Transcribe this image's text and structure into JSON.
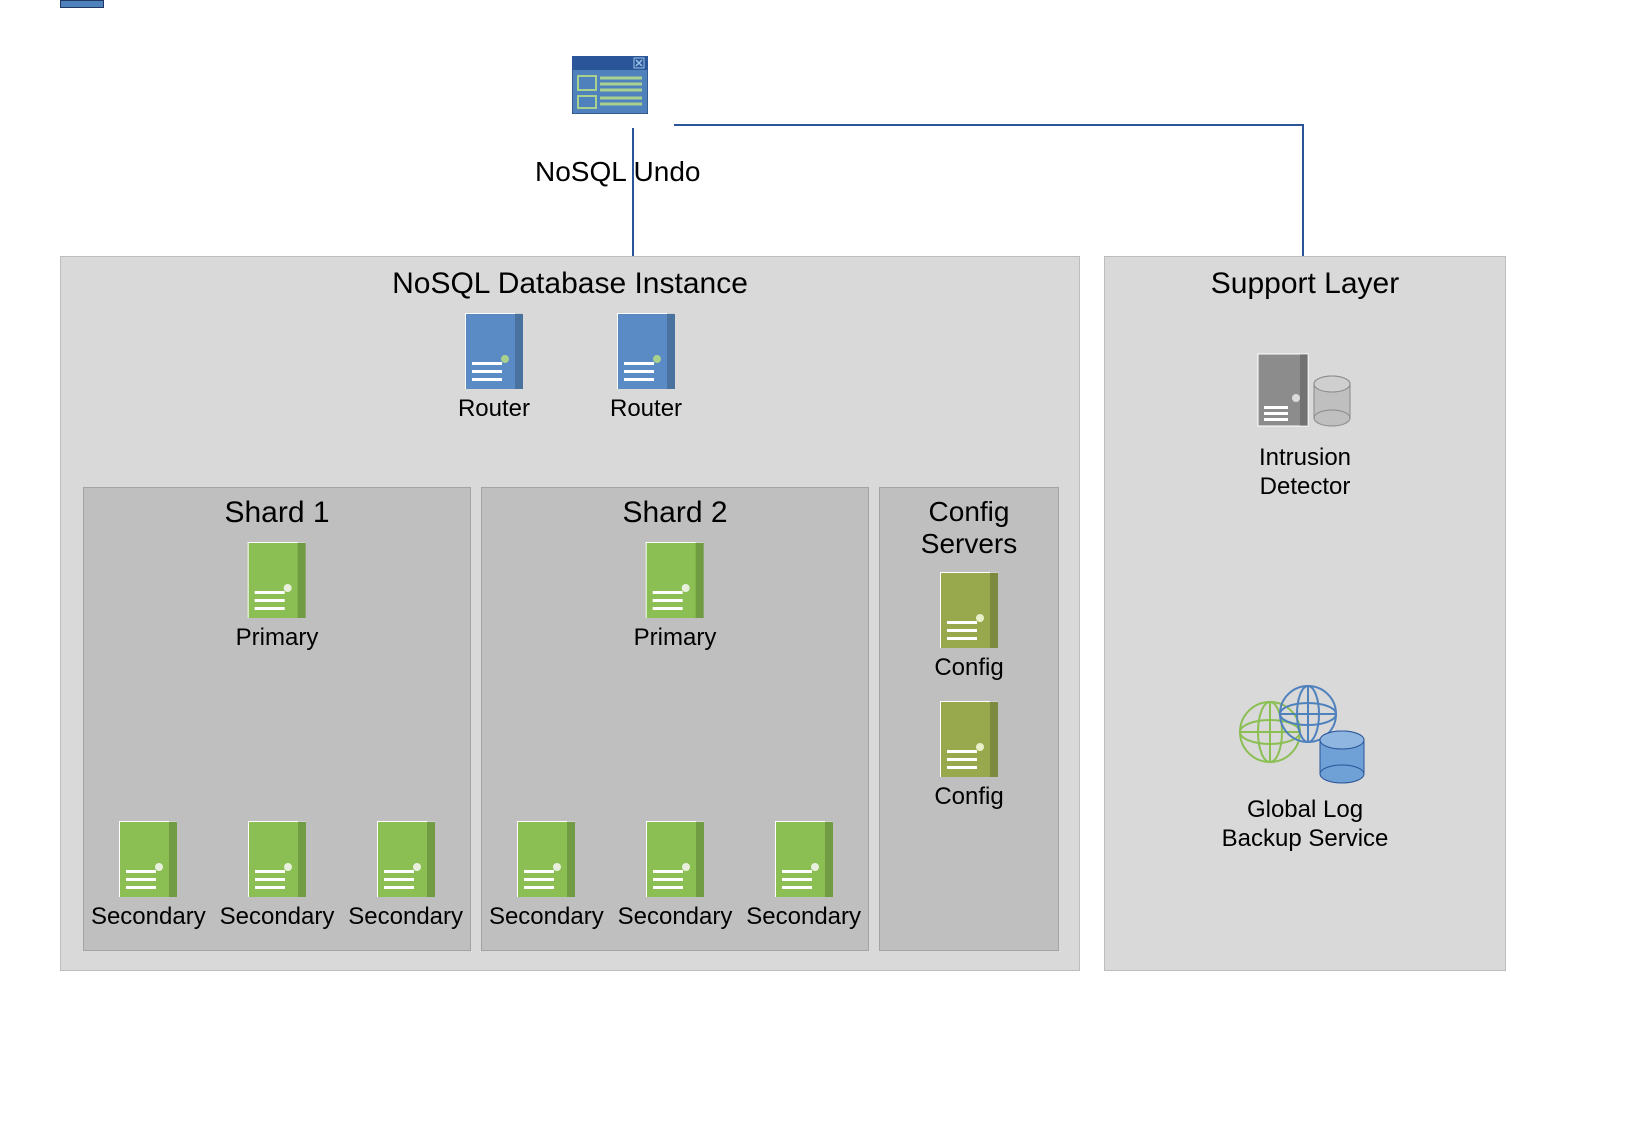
{
  "labels": {
    "undo": "NoSQL Undo",
    "db_title": "NoSQL Database Instance",
    "support_title": "Support Layer",
    "router": "Router",
    "primary": "Primary",
    "secondary": "Secondary",
    "shard1": "Shard 1",
    "shard2": "Shard 2",
    "config_servers_l1": "Config",
    "config_servers_l2": "Servers",
    "config": "Config",
    "intrusion_l1": "Intrusion",
    "intrusion_l2": "Detector",
    "globallog_l1": "Global Log",
    "globallog_l2": "Backup Service"
  },
  "colors": {
    "blue": "#5b8bc5",
    "green": "#8bbf54",
    "olive": "#98a94d",
    "gray": "#8c8c8c",
    "panel": "#d9d9d9",
    "inner": "#bfbfbf",
    "connector": "#2a5599"
  },
  "structure": {
    "client": {
      "type": "browser-window",
      "connects_to": [
        "db_instance",
        "support_layer"
      ]
    },
    "db_instance": {
      "routers": 2,
      "shards": [
        {
          "name": "Shard 1",
          "primary": 1,
          "secondaries": 3
        },
        {
          "name": "Shard 2",
          "primary": 1,
          "secondaries": 3
        }
      ],
      "config_servers": 2
    },
    "support_layer": {
      "components": [
        "Intrusion Detector",
        "Global Log Backup Service"
      ]
    }
  }
}
